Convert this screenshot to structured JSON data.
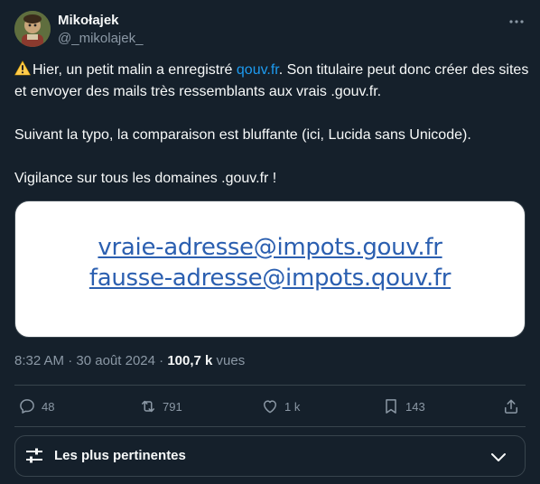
{
  "author": {
    "display_name": "Mikołajek",
    "handle": "@_mikolajek_",
    "avatar_icon": "avatar-image"
  },
  "tweet": {
    "para1_pre": "Hier, un petit malin a enregistré ",
    "para1_link": "qouv.fr",
    "para1_post": ". Son titulaire peut donc créer des sites et envoyer des mails très ressemblants aux vrais .gouv.fr.",
    "para2": "Suivant la typo, la comparaison est bluffante (ici, Lucida sans Unicode).",
    "para3": "Vigilance sur tous les domaines .gouv.fr !",
    "warning_icon": "warning-icon"
  },
  "media": {
    "line1": "vraie-adresse@impots.gouv.fr",
    "line2": "fausse-adresse@impots.qouv.fr"
  },
  "meta": {
    "time": "8:32 AM",
    "separator": "·",
    "date": "30 août 2024",
    "views_count": "100,7 k",
    "views_label": "vues"
  },
  "actions": {
    "replies": "48",
    "reposts": "791",
    "likes": "1 k",
    "bookmarks": "143"
  },
  "sort": {
    "label": "Les plus pertinentes"
  },
  "colors": {
    "background": "#15202b",
    "link": "#1d9bf0",
    "secondary_text": "#8b98a5",
    "border": "#38444d",
    "media_text": "#2b5fb0"
  }
}
